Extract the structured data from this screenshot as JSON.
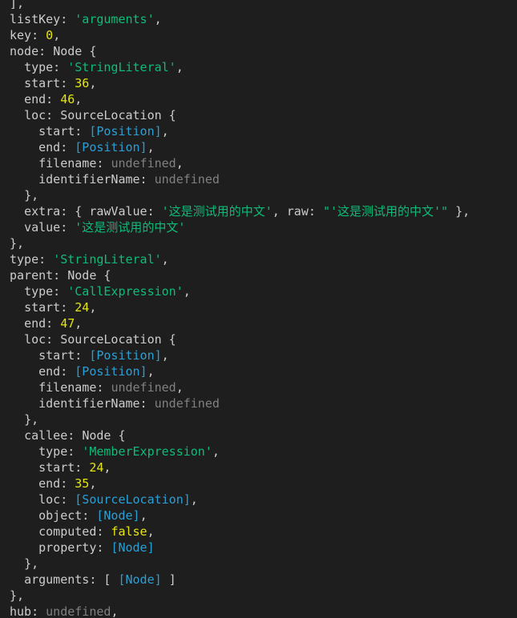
{
  "theme": {
    "background": "#1e1e1e",
    "text": "#cccccc",
    "string": "#0dbc79",
    "number": "#e5e510",
    "undefined": "#808080",
    "reference": "#2a9fd6"
  },
  "lines": [
    {
      "indent": "",
      "tokens": [
        {
          "t": "punct",
          "v": "],"
        }
      ]
    },
    {
      "indent": "",
      "tokens": [
        {
          "t": "key",
          "v": "listKey: "
        },
        {
          "t": "str",
          "v": "'arguments'"
        },
        {
          "t": "punct",
          "v": ","
        }
      ]
    },
    {
      "indent": "",
      "tokens": [
        {
          "t": "key",
          "v": "key: "
        },
        {
          "t": "num",
          "v": "0"
        },
        {
          "t": "punct",
          "v": ","
        }
      ]
    },
    {
      "indent": "",
      "tokens": [
        {
          "t": "key",
          "v": "node: "
        },
        {
          "t": "punct",
          "v": "Node {"
        }
      ]
    },
    {
      "indent": "  ",
      "tokens": [
        {
          "t": "key",
          "v": "type: "
        },
        {
          "t": "str",
          "v": "'StringLiteral'"
        },
        {
          "t": "punct",
          "v": ","
        }
      ]
    },
    {
      "indent": "  ",
      "tokens": [
        {
          "t": "key",
          "v": "start: "
        },
        {
          "t": "num",
          "v": "36"
        },
        {
          "t": "punct",
          "v": ","
        }
      ]
    },
    {
      "indent": "  ",
      "tokens": [
        {
          "t": "key",
          "v": "end: "
        },
        {
          "t": "num",
          "v": "46"
        },
        {
          "t": "punct",
          "v": ","
        }
      ]
    },
    {
      "indent": "  ",
      "tokens": [
        {
          "t": "key",
          "v": "loc: "
        },
        {
          "t": "punct",
          "v": "SourceLocation {"
        }
      ]
    },
    {
      "indent": "    ",
      "tokens": [
        {
          "t": "key",
          "v": "start: "
        },
        {
          "t": "ref",
          "v": "[Position]"
        },
        {
          "t": "punct",
          "v": ","
        }
      ]
    },
    {
      "indent": "    ",
      "tokens": [
        {
          "t": "key",
          "v": "end: "
        },
        {
          "t": "ref",
          "v": "[Position]"
        },
        {
          "t": "punct",
          "v": ","
        }
      ]
    },
    {
      "indent": "    ",
      "tokens": [
        {
          "t": "key",
          "v": "filename: "
        },
        {
          "t": "undef",
          "v": "undefined"
        },
        {
          "t": "punct",
          "v": ","
        }
      ]
    },
    {
      "indent": "    ",
      "tokens": [
        {
          "t": "key",
          "v": "identifierName: "
        },
        {
          "t": "undef",
          "v": "undefined"
        }
      ]
    },
    {
      "indent": "  ",
      "tokens": [
        {
          "t": "punct",
          "v": "},"
        }
      ]
    },
    {
      "indent": "  ",
      "tokens": [
        {
          "t": "key",
          "v": "extra: "
        },
        {
          "t": "punct",
          "v": "{ "
        },
        {
          "t": "key",
          "v": "rawValue: "
        },
        {
          "t": "str",
          "v": "'这是测试用的中文'"
        },
        {
          "t": "punct",
          "v": ", "
        },
        {
          "t": "key",
          "v": "raw: "
        },
        {
          "t": "str",
          "v": "\"'这是测试用的中文'\""
        },
        {
          "t": "punct",
          "v": " },"
        }
      ]
    },
    {
      "indent": "  ",
      "tokens": [
        {
          "t": "key",
          "v": "value: "
        },
        {
          "t": "str",
          "v": "'这是测试用的中文'"
        }
      ]
    },
    {
      "indent": "",
      "tokens": [
        {
          "t": "punct",
          "v": "},"
        }
      ]
    },
    {
      "indent": "",
      "tokens": [
        {
          "t": "key",
          "v": "type: "
        },
        {
          "t": "str",
          "v": "'StringLiteral'"
        },
        {
          "t": "punct",
          "v": ","
        }
      ]
    },
    {
      "indent": "",
      "tokens": [
        {
          "t": "key",
          "v": "parent: "
        },
        {
          "t": "punct",
          "v": "Node {"
        }
      ]
    },
    {
      "indent": "  ",
      "tokens": [
        {
          "t": "key",
          "v": "type: "
        },
        {
          "t": "str",
          "v": "'CallExpression'"
        },
        {
          "t": "punct",
          "v": ","
        }
      ]
    },
    {
      "indent": "  ",
      "tokens": [
        {
          "t": "key",
          "v": "start: "
        },
        {
          "t": "num",
          "v": "24"
        },
        {
          "t": "punct",
          "v": ","
        }
      ]
    },
    {
      "indent": "  ",
      "tokens": [
        {
          "t": "key",
          "v": "end: "
        },
        {
          "t": "num",
          "v": "47"
        },
        {
          "t": "punct",
          "v": ","
        }
      ]
    },
    {
      "indent": "  ",
      "tokens": [
        {
          "t": "key",
          "v": "loc: "
        },
        {
          "t": "punct",
          "v": "SourceLocation {"
        }
      ]
    },
    {
      "indent": "    ",
      "tokens": [
        {
          "t": "key",
          "v": "start: "
        },
        {
          "t": "ref",
          "v": "[Position]"
        },
        {
          "t": "punct",
          "v": ","
        }
      ]
    },
    {
      "indent": "    ",
      "tokens": [
        {
          "t": "key",
          "v": "end: "
        },
        {
          "t": "ref",
          "v": "[Position]"
        },
        {
          "t": "punct",
          "v": ","
        }
      ]
    },
    {
      "indent": "    ",
      "tokens": [
        {
          "t": "key",
          "v": "filename: "
        },
        {
          "t": "undef",
          "v": "undefined"
        },
        {
          "t": "punct",
          "v": ","
        }
      ]
    },
    {
      "indent": "    ",
      "tokens": [
        {
          "t": "key",
          "v": "identifierName: "
        },
        {
          "t": "undef",
          "v": "undefined"
        }
      ]
    },
    {
      "indent": "  ",
      "tokens": [
        {
          "t": "punct",
          "v": "},"
        }
      ]
    },
    {
      "indent": "  ",
      "tokens": [
        {
          "t": "key",
          "v": "callee: "
        },
        {
          "t": "punct",
          "v": "Node {"
        }
      ]
    },
    {
      "indent": "    ",
      "tokens": [
        {
          "t": "key",
          "v": "type: "
        },
        {
          "t": "str",
          "v": "'MemberExpression'"
        },
        {
          "t": "punct",
          "v": ","
        }
      ]
    },
    {
      "indent": "    ",
      "tokens": [
        {
          "t": "key",
          "v": "start: "
        },
        {
          "t": "num",
          "v": "24"
        },
        {
          "t": "punct",
          "v": ","
        }
      ]
    },
    {
      "indent": "    ",
      "tokens": [
        {
          "t": "key",
          "v": "end: "
        },
        {
          "t": "num",
          "v": "35"
        },
        {
          "t": "punct",
          "v": ","
        }
      ]
    },
    {
      "indent": "    ",
      "tokens": [
        {
          "t": "key",
          "v": "loc: "
        },
        {
          "t": "ref",
          "v": "[SourceLocation]"
        },
        {
          "t": "punct",
          "v": ","
        }
      ]
    },
    {
      "indent": "    ",
      "tokens": [
        {
          "t": "key",
          "v": "object: "
        },
        {
          "t": "ref",
          "v": "[Node]"
        },
        {
          "t": "punct",
          "v": ","
        }
      ]
    },
    {
      "indent": "    ",
      "tokens": [
        {
          "t": "key",
          "v": "computed: "
        },
        {
          "t": "bool",
          "v": "false"
        },
        {
          "t": "punct",
          "v": ","
        }
      ]
    },
    {
      "indent": "    ",
      "tokens": [
        {
          "t": "key",
          "v": "property: "
        },
        {
          "t": "ref",
          "v": "[Node]"
        }
      ]
    },
    {
      "indent": "  ",
      "tokens": [
        {
          "t": "punct",
          "v": "},"
        }
      ]
    },
    {
      "indent": "  ",
      "tokens": [
        {
          "t": "key",
          "v": "arguments: "
        },
        {
          "t": "punct",
          "v": "[ "
        },
        {
          "t": "ref",
          "v": "[Node]"
        },
        {
          "t": "punct",
          "v": " ]"
        }
      ]
    },
    {
      "indent": "",
      "tokens": [
        {
          "t": "punct",
          "v": "},"
        }
      ]
    },
    {
      "indent": "",
      "tokens": [
        {
          "t": "key",
          "v": "hub: "
        },
        {
          "t": "undef",
          "v": "undefined"
        },
        {
          "t": "punct",
          "v": ","
        }
      ]
    }
  ]
}
